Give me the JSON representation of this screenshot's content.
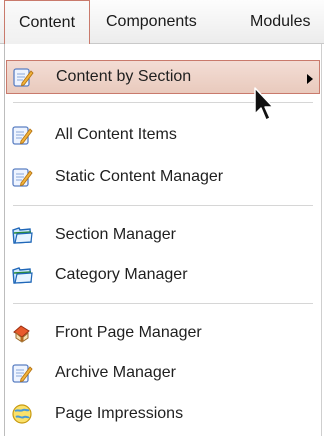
{
  "menubar": {
    "content": "Content",
    "components": "Components",
    "modules": "Modules"
  },
  "dropdown": {
    "items": [
      {
        "label": "Content by Section",
        "icon": "edit-page-icon",
        "submenu": true,
        "highlighted": true
      },
      {
        "label": "All Content Items",
        "icon": "edit-page-icon"
      },
      {
        "label": "Static Content Manager",
        "icon": "edit-page-icon"
      },
      {
        "label": "Section Manager",
        "icon": "folder-icon"
      },
      {
        "label": "Category Manager",
        "icon": "folder-icon"
      },
      {
        "label": "Front Page Manager",
        "icon": "home-page-icon"
      },
      {
        "label": "Archive Manager",
        "icon": "edit-page-icon"
      },
      {
        "label": "Page Impressions",
        "icon": "globe-icon"
      }
    ]
  },
  "colors": {
    "highlight_border": "#c97a6c",
    "highlight_fill": "#ecd1c6"
  }
}
